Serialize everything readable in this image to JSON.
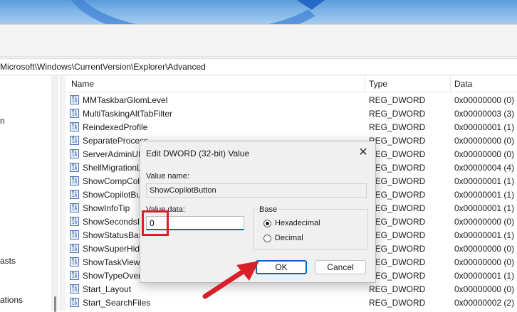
{
  "address": "Microsoft\\Windows\\CurrentVersion\\Explorer\\Advanced",
  "tree": [
    "n",
    "asts",
    "ations"
  ],
  "columns": {
    "name": "Name",
    "type": "Type",
    "data": "Data"
  },
  "rows": [
    {
      "name": "MMTaskbarGlomLevel",
      "type": "REG_DWORD",
      "data": "0x00000000 (0)"
    },
    {
      "name": "MultiTaskingAltTabFilter",
      "type": "REG_DWORD",
      "data": "0x00000003 (3)"
    },
    {
      "name": "ReindexedProfile",
      "type": "REG_DWORD",
      "data": "0x00000001 (1)"
    },
    {
      "name": "SeparateProcess",
      "type": "REG_DWORD",
      "data": "0x00000000 (0)"
    },
    {
      "name": "ServerAdminUI",
      "type": "REG_DWORD",
      "data": "0x00000000 (0)"
    },
    {
      "name": "ShellMigrationL",
      "type": "REG_DWORD",
      "data": "0x00000004 (4)"
    },
    {
      "name": "ShowCompColo",
      "type": "REG_DWORD",
      "data": "0x00000001 (1)"
    },
    {
      "name": "ShowCopilotBu",
      "type": "REG_DWORD",
      "data": "0x00000001 (1)"
    },
    {
      "name": "ShowInfoTip",
      "type": "REG_DWORD",
      "data": "0x00000001 (1)"
    },
    {
      "name": "ShowSecondsIn",
      "type": "REG_DWORD",
      "data": "0x00000000 (0)"
    },
    {
      "name": "ShowStatusBar",
      "type": "REG_DWORD",
      "data": "0x00000001 (1)"
    },
    {
      "name": "ShowSuperHidd",
      "type": "REG_DWORD",
      "data": "0x00000000 (0)"
    },
    {
      "name": "ShowTaskViewB",
      "type": "REG_DWORD",
      "data": "0x00000000 (0)"
    },
    {
      "name": "ShowTypeOverl",
      "type": "REG_DWORD",
      "data": "0x00000001 (1)"
    },
    {
      "name": "Start_Layout",
      "type": "REG_DWORD",
      "data": "0x00000000 (0)"
    },
    {
      "name": "Start_SearchFiles",
      "type": "REG_DWORD",
      "data": "0x00000002 (2)"
    }
  ],
  "dialog": {
    "title": "Edit DWORD (32-bit) Value",
    "close": "✕",
    "value_name_label": "Value name:",
    "value_name": "ShowCopilotButton",
    "value_data_label": "Value data:",
    "value_data": "0",
    "base_label": "Base",
    "hex_label": "Hexadecimal",
    "dec_label": "Decimal",
    "ok_label": "OK",
    "cancel_label": "Cancel"
  },
  "colors": {
    "highlight": "#d8202b",
    "accent": "#0067c0"
  }
}
